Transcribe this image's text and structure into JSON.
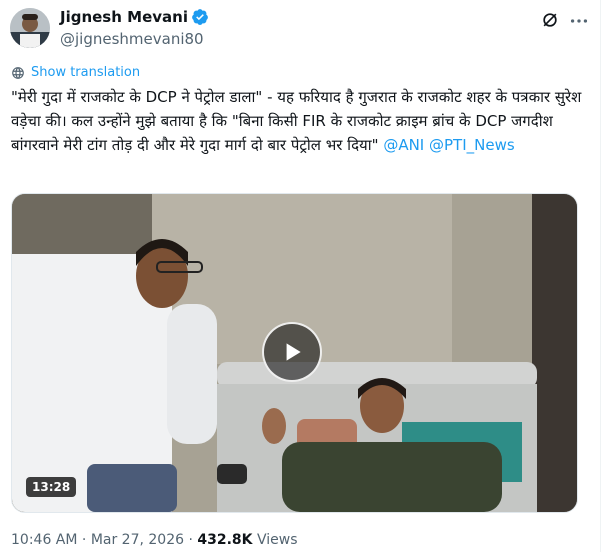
{
  "author": {
    "display_name": "Jignesh Mevani",
    "handle": "@jigneshmevani80"
  },
  "translate_label": "Show translation",
  "tweet": {
    "text": "\"मेरी गुदा में राजकोट के DCP ने पेट्रोल डाला\" - यह फरियाद है गुजरात के राजकोट शहर के पत्रकार सुरेश वड़ेचा की। कल उन्होंने  मुझे बताया है कि \"बिना किसी FIR के राजकोट क्राइम ब्रांच के DCP जगदीश बांगरवाने मेरी टांग तोड़ दी और मेरे गुदा मार्ग दो बार पेट्रोल भर दिया\"",
    "mentions": [
      "@ANI",
      "@PTI_News"
    ]
  },
  "video": {
    "duration": "13:28"
  },
  "meta": {
    "time": "10:46 AM",
    "separator": "·",
    "date": "Mar 27, 2026",
    "views_count": "432.8K",
    "views_label": "Views"
  },
  "colors": {
    "accent": "#1d9bf0",
    "secondary_text": "#536471",
    "primary_text": "#0f1419"
  }
}
